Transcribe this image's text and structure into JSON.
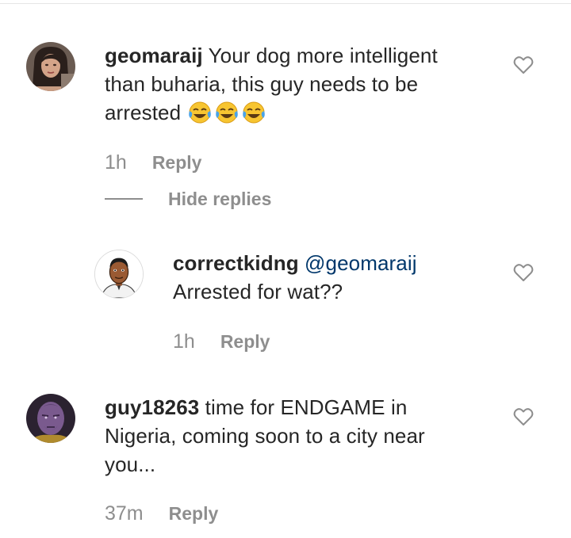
{
  "comments": [
    {
      "username": "geomaraij",
      "text": "Your dog more intelligent than buharia, this guy needs to be arrested",
      "emojis": [
        "joy-emoji",
        "joy-emoji",
        "joy-emoji"
      ],
      "time": "1h",
      "reply_label": "Reply",
      "avatar_icon": "avatar-woman"
    },
    {
      "username": "correctkidng",
      "mention": "@geomaraij",
      "text": "Arrested for wat??",
      "time": "1h",
      "reply_label": "Reply",
      "avatar_icon": "avatar-cartoon-man"
    },
    {
      "username": "guy18263",
      "text": "time for ENDGAME in Nigeria, coming soon to a city near you...",
      "time": "37m",
      "reply_label": "Reply",
      "avatar_icon": "avatar-thanos"
    }
  ],
  "hide_replies_label": "Hide replies",
  "icons": {
    "like": "heart-outline-icon"
  },
  "colors": {
    "text": "#262626",
    "secondary": "#8e8e8e",
    "mention": "#00376b",
    "background": "#ffffff"
  }
}
